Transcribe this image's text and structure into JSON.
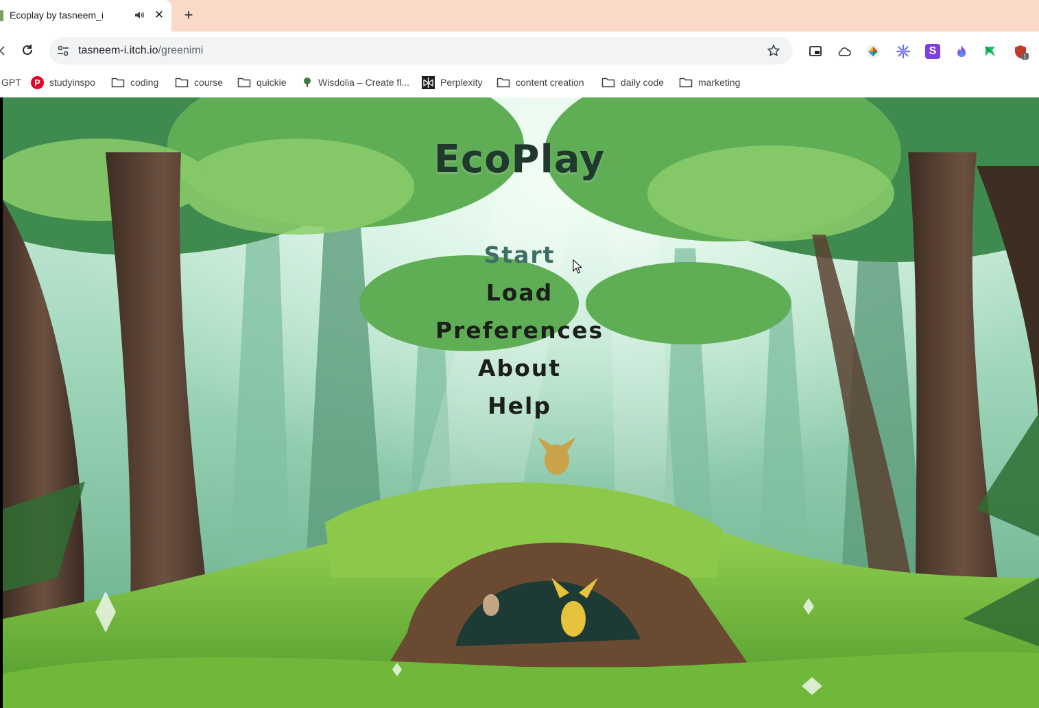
{
  "browser": {
    "tab": {
      "title": "Ecoplay by tasneem_i",
      "close_glyph": "✕"
    },
    "new_tab_glyph": "+",
    "address_bar": {
      "host": "tasneem-i.itch.io",
      "path": "/greenimi"
    },
    "extension_badge_count": "1",
    "extension_s_letter": "S",
    "bookmarks": [
      {
        "label": "GPT",
        "icon": "none"
      },
      {
        "label": "studyinspo",
        "icon": "pinterest-icon"
      },
      {
        "label": "coding",
        "icon": "folder-icon"
      },
      {
        "label": "course",
        "icon": "folder-icon"
      },
      {
        "label": "quickie",
        "icon": "folder-icon"
      },
      {
        "label": "Wisdolia – Create fl...",
        "icon": "wisdolia-icon"
      },
      {
        "label": "Perplexity",
        "icon": "perplexity-icon"
      },
      {
        "label": "content creation",
        "icon": "folder-icon"
      },
      {
        "label": "daily code",
        "icon": "folder-icon"
      },
      {
        "label": "marketing",
        "icon": "folder-icon"
      }
    ]
  },
  "game": {
    "title": "EcoPlay",
    "menu": [
      {
        "label": "Start",
        "state": "hover"
      },
      {
        "label": "Load",
        "state": "normal"
      },
      {
        "label": "Preferences",
        "state": "normal"
      },
      {
        "label": "About",
        "state": "normal"
      },
      {
        "label": "Help",
        "state": "normal"
      }
    ]
  },
  "colors": {
    "tab_strip": "#f9d9c8",
    "title_text": "#1f3a2c",
    "menu_text": "#1b1f1a",
    "menu_hover": "#3f6f63",
    "forest_light": "#a9dcc0",
    "grass": "#7cc243"
  }
}
